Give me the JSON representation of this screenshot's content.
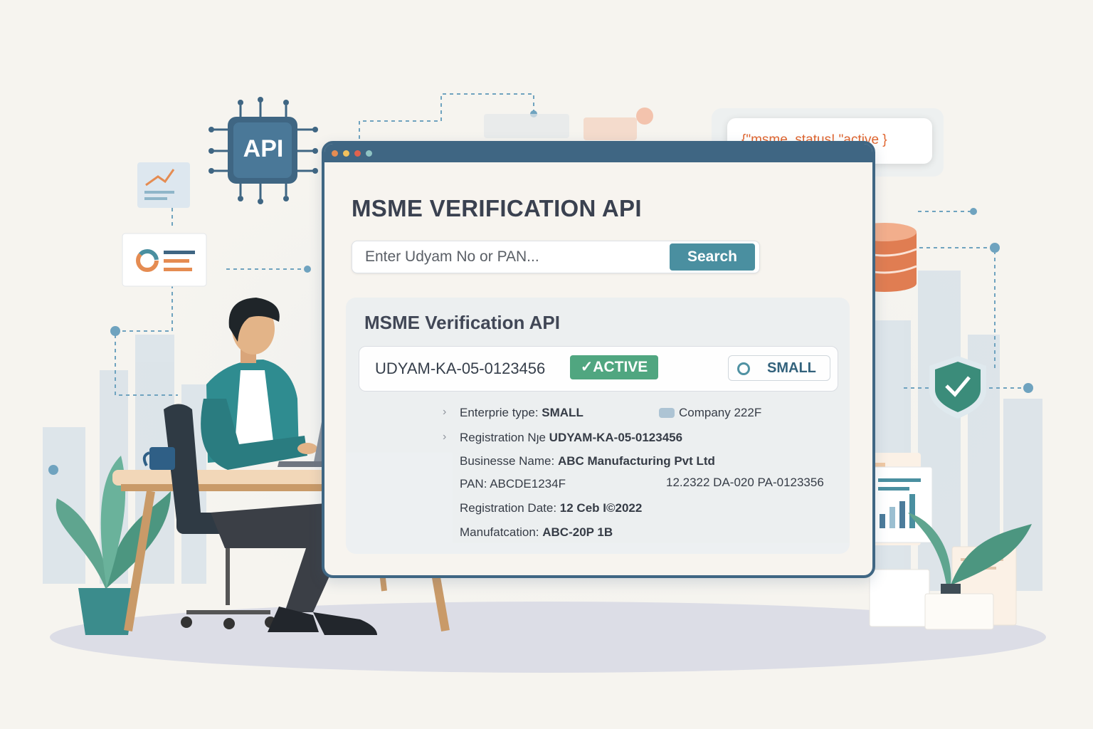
{
  "json_bubble": {
    "text": "{\"msme_status!  \"active }"
  },
  "api_chip": {
    "label": "API"
  },
  "window": {
    "title": "MSME VERIFICATION API",
    "search": {
      "placeholder": "Enter Udyam No or PAN...",
      "button_label": "Search"
    },
    "card": {
      "title": "MSME Verification API",
      "udyam_number": "UDYAM-KA-05-0123456",
      "status_badge": "✓ACTIVE",
      "category_badge": "SMALL",
      "details": [
        {
          "label": "Enterprie type: ",
          "value": "SMALL"
        },
        {
          "label": "Registration Nȷe ",
          "value": "UDYAM-KA-05-0123456"
        },
        {
          "label": "Businesse Name: ",
          "value": "ABC Manufacturing Pvt Ltd"
        },
        {
          "label": "PAN: ABCDE1234F",
          "value": ""
        },
        {
          "label": "Registration Date:  ",
          "value": "12 Ceb I©2022"
        },
        {
          "label": "Manufatcation:    ",
          "value": "ABC-20P 1B"
        }
      ],
      "side_details": [
        {
          "text": "Company 222F"
        },
        {
          "text": "12.2322 DA-020 PA-0123356"
        }
      ]
    }
  },
  "colors": {
    "window_frame": "#3f6683",
    "accent_teal": "#4a8fa0",
    "active_green": "#4aa37c",
    "json_orange": "#e0652f",
    "db_blue": "#4c7c9b",
    "db_orange": "#e07d52"
  },
  "icons": [
    "api-chip-icon",
    "database-icon",
    "shield-check-icon",
    "chart-card-icon",
    "donut-card-icon",
    "coffee-mug-icon",
    "laptop-icon",
    "plant-icon"
  ]
}
